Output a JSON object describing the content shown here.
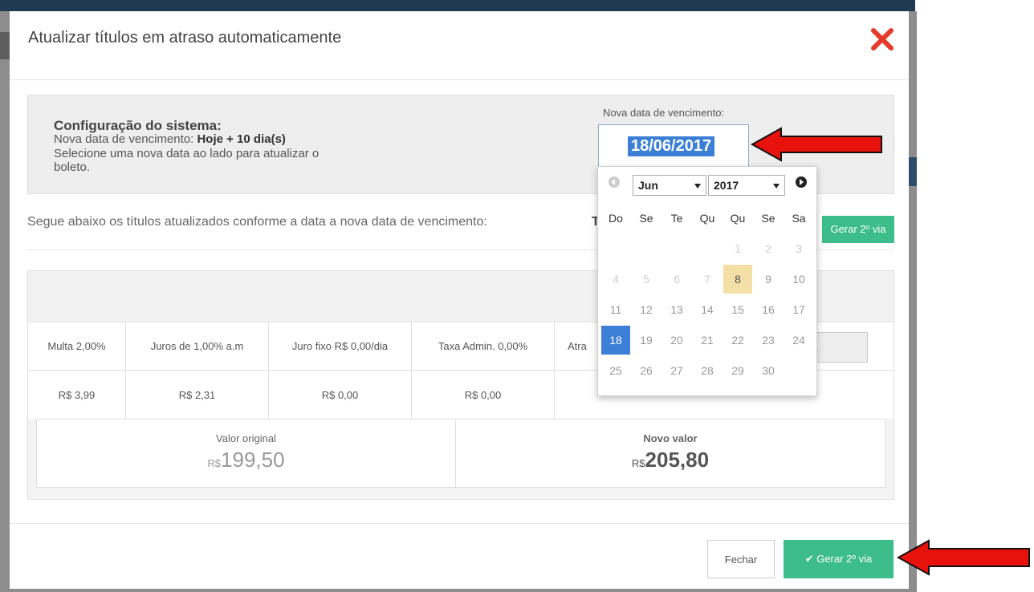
{
  "modal": {
    "title": "Atualizar títulos em atraso automaticamente"
  },
  "config": {
    "title": "Configuração do sistema:",
    "due_prefix": "Nova data de vencimento: ",
    "due_value": "Hoje + 10 dia(s)",
    "hint_line1": "Selecione uma nova data ao lado para atualizar o",
    "hint_line2": "boleto.",
    "date_label": "Nova data de vencimento:",
    "date_value": "18/06/2017"
  },
  "follow": {
    "text": "Segue abaixo os títulos atualizados conforme a data a nova data de vencimento:",
    "cut_text": "T",
    "gerar_label": "Gerar 2º via"
  },
  "table": {
    "header_row": [
      "Multa 2,00%",
      "Juros de 1,00% a.m",
      "Juro fixo R$ 0,00/dia",
      "Taxa Admin. 0,00%",
      "Atra"
    ],
    "value_row": [
      "R$ 3,99",
      "R$ 2,31",
      "R$ 0,00",
      "R$ 0,00"
    ],
    "extra_input_value": "..."
  },
  "values": {
    "original_label": "Valor original",
    "original_currency": "R$",
    "original_amount": "199,50",
    "new_label": "Novo valor",
    "new_currency": "R$",
    "new_amount": "205,80"
  },
  "footer": {
    "close_label": "Fechar",
    "generate_label": "Gerar 2º via"
  },
  "datepicker": {
    "month": "Jun",
    "year": "2017",
    "weekdays": [
      "Do",
      "Se",
      "Te",
      "Qu",
      "Qu",
      "Se",
      "Sa"
    ],
    "days": [
      "1",
      "2",
      "3",
      "4",
      "5",
      "6",
      "7",
      "8",
      "9",
      "10",
      "11",
      "12",
      "13",
      "14",
      "15",
      "16",
      "17",
      "18",
      "19",
      "20",
      "21",
      "22",
      "23",
      "24",
      "25",
      "26",
      "27",
      "28",
      "29",
      "30"
    ],
    "first_weekday_index": 4,
    "today": "8",
    "selected": "18"
  },
  "colors": {
    "accent_green": "#3dbd89",
    "selection_blue": "#3b7fd6",
    "close_red": "#e53b2c",
    "arrow_red": "#e8120c"
  }
}
